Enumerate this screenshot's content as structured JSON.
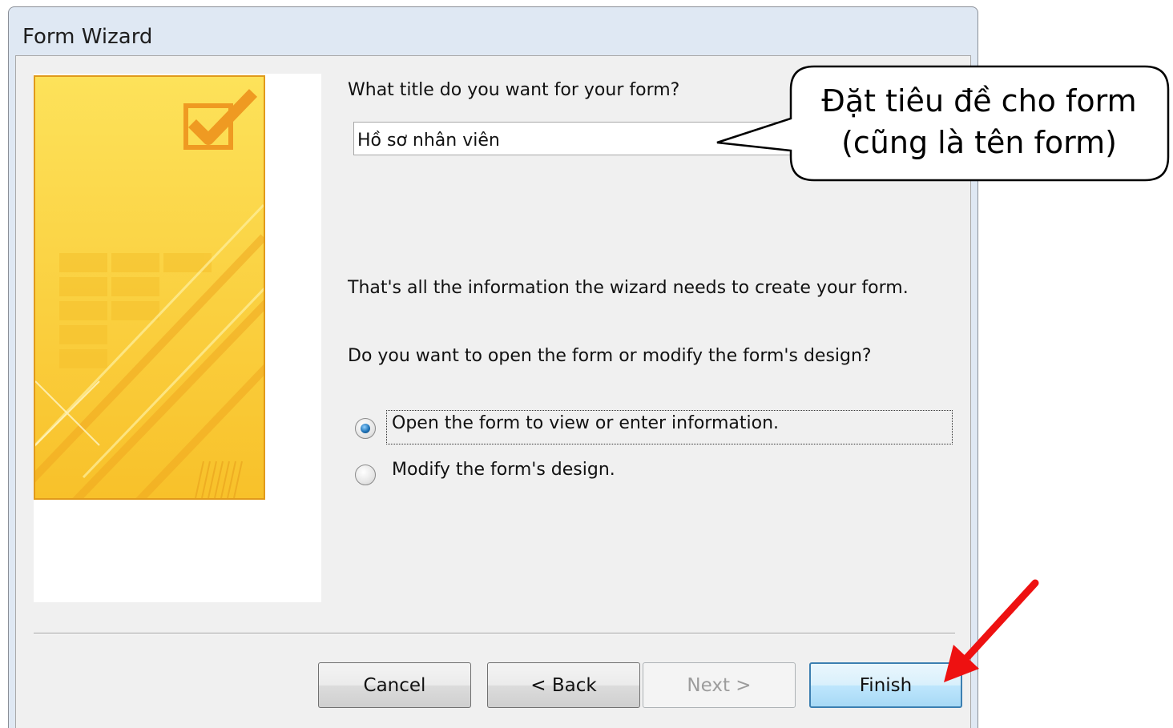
{
  "window": {
    "title": "Form Wizard"
  },
  "form": {
    "title_prompt": "What title do you want for your form?",
    "title_value": "Hồ sơ nhân viên",
    "info_text": "That's all the information the wizard needs to create your form.",
    "question_text": "Do you want to open the form or modify the form's design?",
    "options": [
      {
        "label": "Open the form to view or enter information.",
        "selected": true
      },
      {
        "label": "Modify the form's design.",
        "selected": false
      }
    ]
  },
  "buttons": {
    "cancel": "Cancel",
    "back": "< Back",
    "next": "Next >",
    "finish": "Finish"
  },
  "annotation": {
    "callout_line1": "Đặt tiêu đề cho form",
    "callout_line2": "(cũng là tên form)"
  },
  "colors": {
    "banner_yellow": "#fcd73c",
    "banner_border": "#e19a1b",
    "arrow_red": "#ee1111",
    "default_button_border": "#3c7fb1"
  },
  "icons": {
    "banner_check": "checkbox-check-icon",
    "pointer_arrow": "red-arrow-icon"
  }
}
